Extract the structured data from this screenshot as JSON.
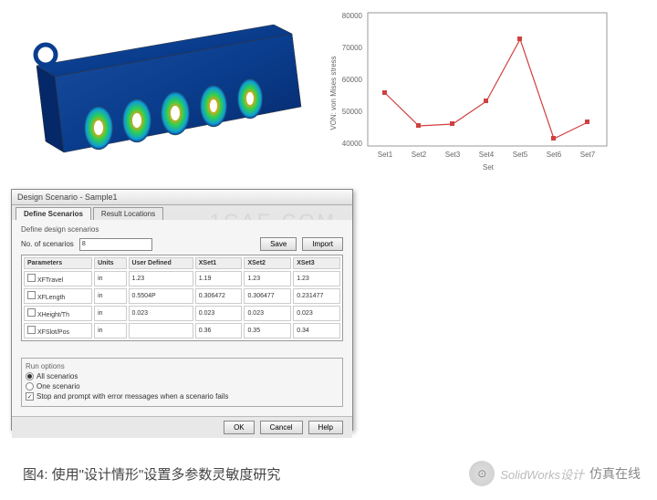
{
  "chart_data": {
    "type": "line",
    "title": "",
    "xlabel": "Set",
    "ylabel": "VON: von Mises stress",
    "ylim": [
      40000,
      80000
    ],
    "yticks": [
      40000,
      50000,
      60000,
      70000,
      80000
    ],
    "categories": [
      "Set1",
      "Set2",
      "Set3",
      "Set4",
      "Set5",
      "Set6",
      "Set7"
    ],
    "values": [
      56000,
      46000,
      46500,
      53500,
      72500,
      42000,
      47000
    ]
  },
  "dialog": {
    "title": "Design Scenario - Sample1",
    "tabs": {
      "scenarios": "Define Scenarios",
      "results": "Result Locations"
    },
    "define_label": "Define design scenarios",
    "no_scenarios_label": "No. of scenarios",
    "no_scenarios_value": "8",
    "save_btn": "Save",
    "import_btn": "Import",
    "table": {
      "headers": [
        "Parameters",
        "Units",
        "User Defined",
        "XSet1",
        "XSet2",
        "XSet3"
      ],
      "rows": [
        [
          "XFTravel",
          "in",
          "1.23",
          "1.19",
          "1.23",
          "1.23"
        ],
        [
          "XFLength",
          "in",
          "0.5504P",
          "0.306472",
          "0.306477",
          "0.231477"
        ],
        [
          "XHeight/Th",
          "in",
          "0.023",
          "0.023",
          "0.023",
          "0.023"
        ],
        [
          "XFSlot/Pos",
          "in",
          "",
          "0.36",
          "0.35",
          "0.34"
        ]
      ]
    },
    "run_options": {
      "legend": "Run options",
      "all": "All scenarios",
      "one": "One scenario",
      "stop_prompt": "Stop and prompt with error messages when a scenario fails"
    },
    "buttons": {
      "ok": "OK",
      "cancel": "Cancel",
      "help": "Help"
    }
  },
  "caption": "图4: 使用\"设计情形\"设置多参数灵敏度研究",
  "watermark": {
    "center": "1CAE.COM",
    "brand": "SolidWorks设计",
    "site": "仿真在线"
  }
}
